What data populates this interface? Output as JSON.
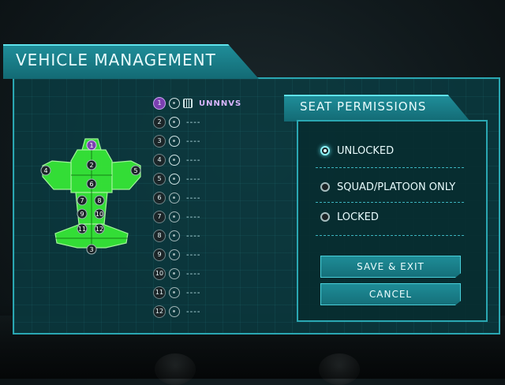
{
  "header": {
    "title": "VEHICLE MANAGEMENT"
  },
  "seats": [
    {
      "number": "1",
      "name": "UNNNVS",
      "active": true
    },
    {
      "number": "2",
      "name": "----"
    },
    {
      "number": "3",
      "name": "----"
    },
    {
      "number": "4",
      "name": "----"
    },
    {
      "number": "5",
      "name": "----"
    },
    {
      "number": "6",
      "name": "----"
    },
    {
      "number": "7",
      "name": "----"
    },
    {
      "number": "8",
      "name": "----"
    },
    {
      "number": "9",
      "name": "----"
    },
    {
      "number": "10",
      "name": "----"
    },
    {
      "number": "11",
      "name": "----"
    },
    {
      "number": "12",
      "name": "----"
    }
  ],
  "vehicle_map": {
    "seat_labels": [
      "1",
      "2",
      "3",
      "4",
      "5",
      "6",
      "7",
      "8",
      "9",
      "10",
      "11",
      "12"
    ],
    "highlighted_seat": "1"
  },
  "permissions": {
    "title": "SEAT PERMISSIONS",
    "options": [
      {
        "label": "UNLOCKED",
        "selected": true
      },
      {
        "label": "SQUAD/PLATOON ONLY",
        "selected": false
      },
      {
        "label": "LOCKED",
        "selected": false
      }
    ]
  },
  "buttons": {
    "save_exit": "SAVE & EXIT",
    "cancel": "CANCEL"
  },
  "colors": {
    "accent": "#2aa7b2",
    "vehicle": "#3cff3c",
    "active_seat": "#7b3fb0"
  }
}
